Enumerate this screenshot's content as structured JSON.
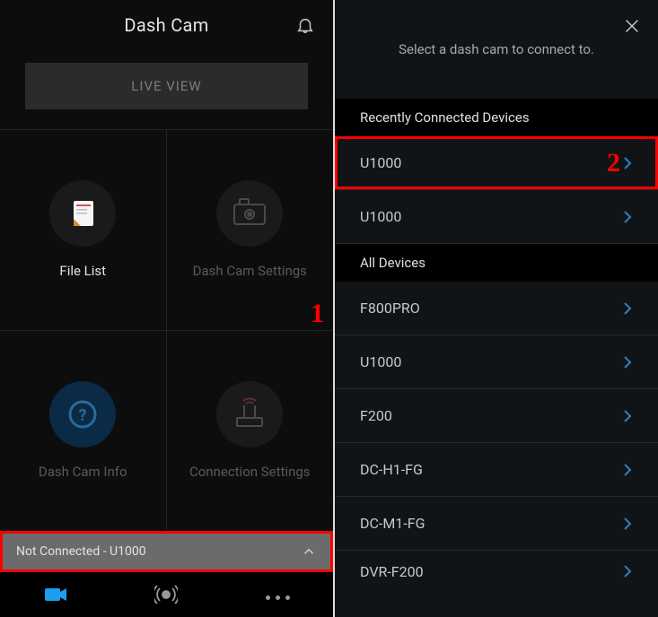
{
  "left": {
    "header": {
      "title": "Dash Cam"
    },
    "live_button": "LIVE VIEW",
    "tiles": {
      "file_list": "File List",
      "settings": "Dash Cam Settings",
      "info": "Dash Cam Info",
      "connection": "Connection Settings"
    },
    "status_bar": "Not Connected - U1000",
    "annotation_1": "1"
  },
  "right": {
    "prompt": "Select a dash cam to connect to.",
    "sections": {
      "recent": "Recently Connected Devices",
      "all": "All Devices"
    },
    "recent_devices": [
      "U1000",
      "U1000"
    ],
    "all_devices": [
      "F800PRO",
      "U1000",
      "F200",
      "DC-H1-FG",
      "DC-M1-FG",
      "DVR-F200"
    ],
    "annotation_2": "2"
  }
}
